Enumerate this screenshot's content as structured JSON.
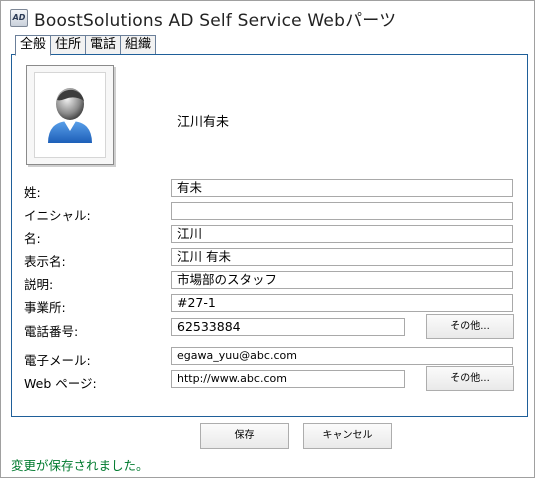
{
  "window": {
    "title": "BoostSolutions AD Self Service Webパーツ",
    "icon": "ad-app-icon"
  },
  "tabs": [
    {
      "label": "全般",
      "active": true
    },
    {
      "label": "住所",
      "active": false
    },
    {
      "label": "電話",
      "active": false
    },
    {
      "label": "組織",
      "active": false
    }
  ],
  "profile": {
    "display_name": "江川有未",
    "photo_icon": "user-avatar-icon"
  },
  "fields": [
    {
      "label": "姓:",
      "value": "有未"
    },
    {
      "label": "イニシャル:",
      "value": ""
    },
    {
      "label": "名:",
      "value": "江川"
    },
    {
      "label": "表示名:",
      "value": "江川 有未"
    },
    {
      "label": "説明:",
      "value": "市場部のスタッフ"
    },
    {
      "label": "事業所:",
      "value": "#27-1"
    },
    {
      "label": "電話番号:",
      "value": "62533884",
      "other_button": "その他..."
    },
    {
      "label": "電子メール:",
      "value": "egawa_yuu@abc.com"
    },
    {
      "label": "Web ページ:",
      "value": "http://www.abc.com",
      "other_button": "その他..."
    }
  ],
  "buttons": {
    "save": "保存",
    "cancel": "キャンセル"
  },
  "status_message": "変更が保存されました。",
  "colors": {
    "panel_border": "#1f5f99",
    "status_text": "#007a2e"
  }
}
